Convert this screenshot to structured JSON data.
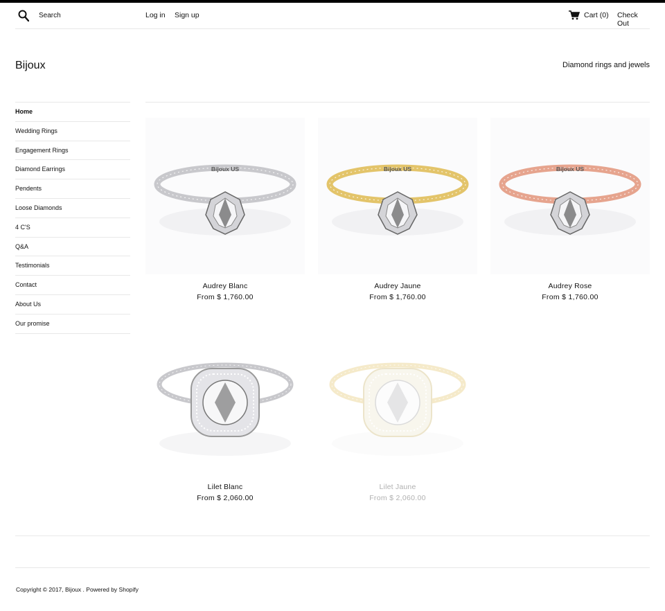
{
  "header": {
    "search_placeholder": "Search",
    "login": "Log in",
    "signup": "Sign up",
    "cart": "Cart (0)",
    "checkout": "Check Out",
    "search_icon": "search-icon",
    "cart_icon": "cart-icon"
  },
  "brand": {
    "name": "Bijoux",
    "tagline": "Diamond rings and jewels"
  },
  "sidebar": {
    "items": [
      {
        "label": "Home",
        "active": true
      },
      {
        "label": "Wedding Rings"
      },
      {
        "label": "Engagement Rings"
      },
      {
        "label": "Diamond Earrings"
      },
      {
        "label": "Pendents"
      },
      {
        "label": "Loose Diamonds"
      },
      {
        "label": "4 C'S"
      },
      {
        "label": "Q&A"
      },
      {
        "label": "Testimonials"
      },
      {
        "label": "Contact"
      },
      {
        "label": "About Us"
      },
      {
        "label": "Our promise"
      }
    ]
  },
  "products": [
    {
      "name": "Audrey Blanc",
      "price": "From $ 1,760.00",
      "metal": "#c8c8cc",
      "engraving": "Bijoux US",
      "style": "solitaire"
    },
    {
      "name": "Audrey Jaune",
      "price": "From $ 1,760.00",
      "metal": "#e3c46a",
      "engraving": "Bijoux US",
      "style": "solitaire"
    },
    {
      "name": "Audrey Rose",
      "price": "From $ 1,760.00",
      "metal": "#e6a48e",
      "engraving": "Bijoux US",
      "style": "solitaire"
    },
    {
      "name": "Lilet Blanc",
      "price": "From $ 2,060.00",
      "metal": "#c8c8cc",
      "style": "halo"
    },
    {
      "name": "Lilet Jaune",
      "price": "From $ 2,060.00",
      "metal": "#e3c46a",
      "style": "halo",
      "faded": true
    }
  ],
  "footer": {
    "copyright_prefix": "Copyright © 2017,",
    "shop_link": "Bijoux",
    "separator": ".",
    "powered": "Powered by Shopify"
  }
}
